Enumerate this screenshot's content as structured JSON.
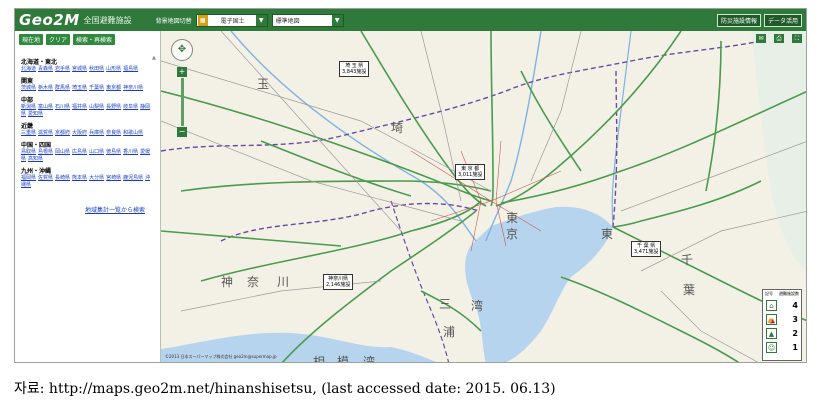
{
  "header": {
    "logo": "Geo2M",
    "logo_sub": "全国避難施設",
    "basemap_label": "背景地図切替",
    "basemap_select": "電子国土",
    "layer_select": "標準地図",
    "right_buttons": [
      "防災施設情報",
      "データ活用"
    ]
  },
  "sidebar": {
    "tools": [
      "現在地",
      "クリア",
      "検索・再検索"
    ],
    "regions": [
      {
        "title": "北海道・東北",
        "links": [
          "北海道",
          "青森県",
          "岩手県",
          "宮城県",
          "秋田県",
          "山形県",
          "福島県"
        ]
      },
      {
        "title": "関東",
        "links": [
          "茨城県",
          "栃木県",
          "群馬県",
          "埼玉県",
          "千葉県",
          "東京都",
          "神奈川県"
        ]
      },
      {
        "title": "中部",
        "links": [
          "新潟県",
          "富山県",
          "石川県",
          "福井県",
          "山梨県",
          "長野県",
          "岐阜県",
          "静岡県",
          "愛知県"
        ]
      },
      {
        "title": "近畿",
        "links": [
          "三重県",
          "滋賀県",
          "京都府",
          "大阪府",
          "兵庫県",
          "奈良県",
          "和歌山県"
        ]
      },
      {
        "title": "中国・四国",
        "links": [
          "鳥取県",
          "島根県",
          "岡山県",
          "広島県",
          "山口県",
          "徳島県",
          "香川県",
          "愛媛県",
          "高知県"
        ]
      },
      {
        "title": "九州・沖縄",
        "links": [
          "福岡県",
          "佐賀県",
          "長崎県",
          "熊本県",
          "大分県",
          "宮崎県",
          "鹿児島県",
          "沖縄県"
        ]
      }
    ],
    "stats_link": "地域集計一覧から検索"
  },
  "map": {
    "labels": [
      "埼",
      "玉",
      "東",
      "京",
      "千",
      "葉",
      "神",
      "奈",
      "川",
      "三",
      "浦",
      "相",
      "模",
      "湾",
      "東",
      "京",
      "湾"
    ],
    "callouts": [
      {
        "name": "埼 玉 県",
        "count": "3,843施設"
      },
      {
        "name": "東 京 都",
        "count": "3,011施設"
      },
      {
        "name": "千 葉 県",
        "count": "3,471施設"
      },
      {
        "name": "神奈川県",
        "count": "2,146施設"
      }
    ],
    "copyright": "©2013 日本スーパーマップ株式会社 geo2m@supermap.jp"
  },
  "legend": {
    "head_left": "記号",
    "head_right": "避難施設数",
    "rows": [
      {
        "icon": "shelter-icon",
        "value": "4"
      },
      {
        "icon": "evacuation-icon",
        "value": "3"
      },
      {
        "icon": "ground-icon",
        "value": "2"
      },
      {
        "icon": "person-icon",
        "value": "1"
      }
    ]
  },
  "caption": "자료: http://maps.geo2m.net/hinanshisetsu, (last accessed date: 2015. 06.13)",
  "colors": {
    "brand": "#2f7a3a",
    "water": "#b7d4ee",
    "road_green": "#4a9a4f",
    "road_purple": "#6a4aa0"
  }
}
